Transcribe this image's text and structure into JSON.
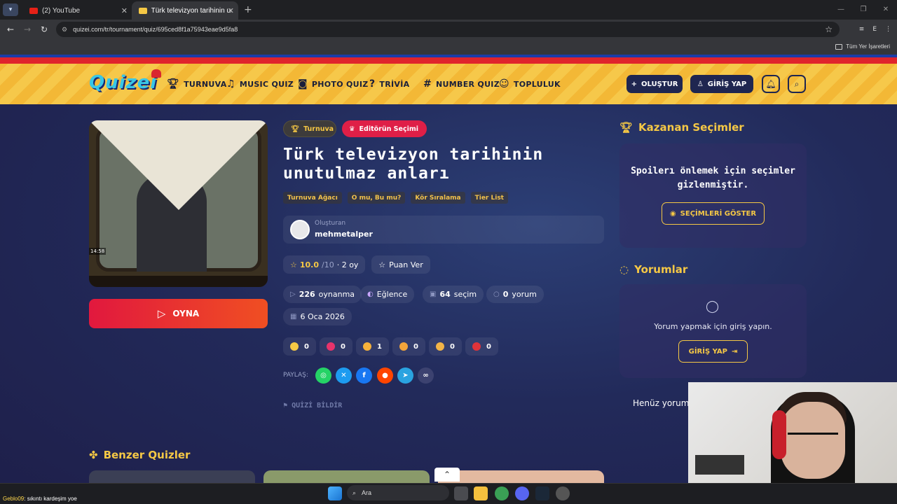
{
  "browser": {
    "tabs": [
      {
        "label": "(2) YouTube",
        "active": false
      },
      {
        "label": "Türk televizyon tarihinin unutul",
        "active": true
      }
    ],
    "url": "quizei.com/tr/tournament/quiz/695ced8f1a75943eae9d5fa8",
    "bookmarks_folder": "Tüm Yer İşaretleri",
    "profile_initial": "E"
  },
  "header": {
    "logo": "Quizei",
    "nav": [
      {
        "label": "TURNUVA",
        "icon": "trophy-icon"
      },
      {
        "label": "MUSIC QUIZ",
        "icon": "music-note-icon"
      },
      {
        "label": "PHOTO QUIZ",
        "icon": "camera-icon"
      },
      {
        "label": "TRİVİA",
        "icon": "question-bubble-icon"
      },
      {
        "label": "NUMBER QUIZ",
        "icon": "hash-icon"
      },
      {
        "label": "TOPLULUK",
        "icon": "users-icon"
      }
    ],
    "create_label": "OLUŞTUR",
    "login_label": "GİRİŞ YAP"
  },
  "quiz": {
    "badge_tournament": "Turnuva",
    "badge_editor": "Editörün Seçimi",
    "title": "Türk televizyon tarihinin unutulmaz anları",
    "modes": [
      "Turnuva Ağacı",
      "O mu, Bu mu?",
      "Kör Sıralama",
      "Tier List"
    ],
    "creator_label": "Oluşturan",
    "creator_name": "mehmetalper",
    "rating_score": "10.0",
    "rating_total": "/10",
    "rating_age": "· 2 oy",
    "rate_label": "Puan Ver",
    "stats": {
      "plays": "226",
      "plays_label": "oynanma",
      "category": "Eğlence",
      "choices": "64",
      "choices_label": "seçim",
      "comments": "0",
      "comments_label": "yorum",
      "date": "6 Oca 2026"
    },
    "reactions": [
      {
        "emoji": "thumbs-up-icon",
        "count": "0"
      },
      {
        "emoji": "heart-icon",
        "count": "0"
      },
      {
        "emoji": "laugh-icon",
        "count": "1"
      },
      {
        "emoji": "surprised-icon",
        "count": "0"
      },
      {
        "emoji": "sad-icon",
        "count": "0"
      },
      {
        "emoji": "angry-icon",
        "count": "0"
      }
    ],
    "share_label": "PAYLAŞ:",
    "report_label": "QUİZİ BİLDİR",
    "play_label": "OYNA",
    "thumb_time": "14:58"
  },
  "sidebar": {
    "winners_title": "Kazanan Seçimler",
    "spoiler_text": "Spoilerı önlemek için seçimler gizlenmiştir.",
    "show_choices_label": "SEÇİMLERİ GÖSTER",
    "comments_title": "Yorumlar",
    "comments_prompt": "Yorum yapmak için giriş yapın.",
    "comments_login": "GİRİŞ YAP",
    "no_comments": "Henüz yorum"
  },
  "similar": {
    "title": "Benzer Quizler"
  },
  "taskbar": {
    "search_placeholder": "Ara",
    "chat_user": "Geblo09",
    "chat_message": ": sıkıntı kardeşim yoe"
  },
  "colors": {
    "accent": "#f5c845",
    "play_red": "#e1183e",
    "editor_red": "#df1f47",
    "nav_dark": "#1f2650"
  }
}
